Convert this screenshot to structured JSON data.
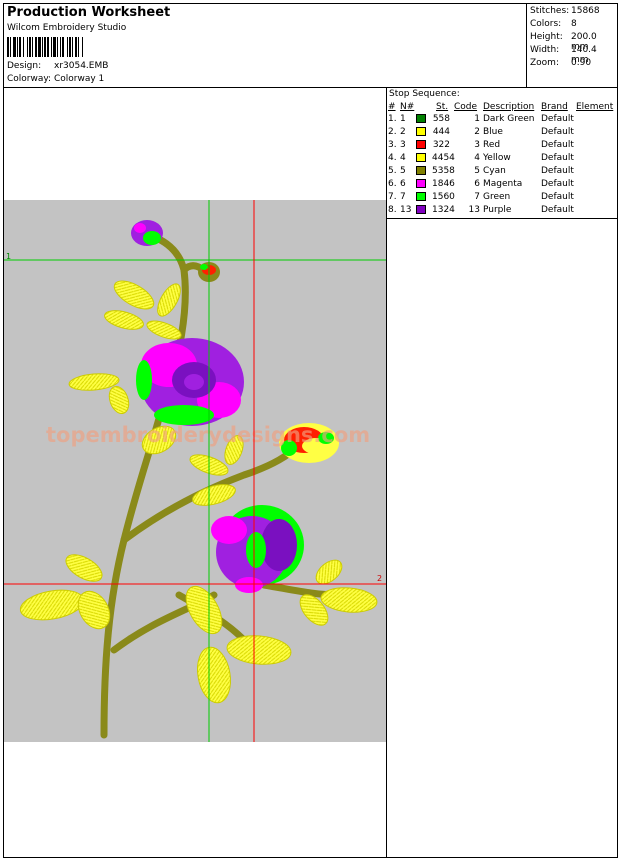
{
  "header": {
    "title": "Production Worksheet",
    "software": "Wilcom  Embroidery Studio",
    "design_label": "Design:",
    "design_value": "xr3054.EMB",
    "colorway_label": "Colorway:",
    "colorway_value": "Colorway 1"
  },
  "stats": [
    {
      "label": "Stitches:",
      "value": "15868"
    },
    {
      "label": "Colors:",
      "value": "8"
    },
    {
      "label": "Height:",
      "value": "200.0 mm"
    },
    {
      "label": "Width:",
      "value": "140.4 mm"
    },
    {
      "label": "Zoom:",
      "value": "0.90"
    }
  ],
  "stop_sequence": {
    "title": "Stop Sequence:",
    "headers": {
      "num": "#",
      "nn": "N#",
      "st": "St.",
      "code": "Code",
      "description": "Description",
      "brand": "Brand",
      "element": "Element"
    },
    "rows": [
      {
        "num": "1.",
        "nn": "1",
        "color": "#008000",
        "st": "558",
        "code": "1",
        "description": "Dark Green",
        "brand": "Default"
      },
      {
        "num": "2.",
        "nn": "2",
        "color": "#ffff00",
        "st": "444",
        "code": "2",
        "description": "Blue",
        "brand": "Default"
      },
      {
        "num": "3.",
        "nn": "3",
        "color": "#ff0000",
        "st": "322",
        "code": "3",
        "description": "Red",
        "brand": "Default"
      },
      {
        "num": "4.",
        "nn": "4",
        "color": "#ffff00",
        "st": "4454",
        "code": "4",
        "description": "Yellow",
        "brand": "Default"
      },
      {
        "num": "5.",
        "nn": "5",
        "color": "#808000",
        "st": "5358",
        "code": "5",
        "description": "Cyan",
        "brand": "Default"
      },
      {
        "num": "6.",
        "nn": "6",
        "color": "#ff00ff",
        "st": "1846",
        "code": "6",
        "description": "Magenta",
        "brand": "Default"
      },
      {
        "num": "7.",
        "nn": "7",
        "color": "#00ff00",
        "st": "1560",
        "code": "7",
        "description": "Green",
        "brand": "Default"
      },
      {
        "num": "8.",
        "nn": "13",
        "color": "#8000c0",
        "st": "1324",
        "code": "13",
        "description": "Purple",
        "brand": "Default"
      }
    ]
  },
  "preview": {
    "watermark": "topembroiderydesigns.com",
    "guide_green_label": "1",
    "guide_red_label": "2",
    "colors": {
      "background": "#c3c3c3",
      "stem": "#8a8a1a",
      "leaf": "#ffff44",
      "petal_purple": "#a020e0",
      "petal_magenta": "#ff00ff",
      "petal_green": "#00ff00",
      "bud_red": "#ff2000"
    }
  }
}
